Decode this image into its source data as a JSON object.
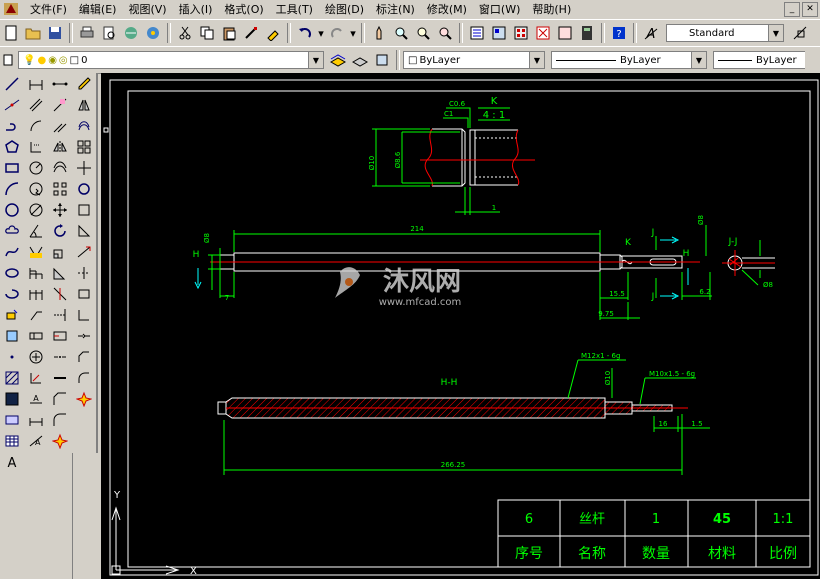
{
  "menu": [
    "文件(F)",
    "编辑(E)",
    "视图(V)",
    "插入(I)",
    "格式(O)",
    "工具(T)",
    "绘图(D)",
    "标注(N)",
    "修改(M)",
    "窗口(W)",
    "帮助(H)"
  ],
  "toolbar": {
    "text_style": "Standard",
    "layer": "0",
    "color": "ByLayer",
    "linetype": "ByLayer",
    "lineweight": "ByLayer"
  },
  "colors": {
    "canvas": "#000000",
    "dim": "#00ff00",
    "geometry": "#ffffff",
    "center": "#ff0000",
    "table_text": "#00ff00"
  },
  "drawing": {
    "detail_label": "K",
    "detail_scale": "4 : 1",
    "chamfer1": "C0.6",
    "chamfer2": "C1",
    "dia10": "Ø10",
    "dia86": "Ø8.6",
    "detail_dim": "1",
    "dim_214": "214",
    "dim_8": "Ø8",
    "dim_7": "7",
    "dim_155": "15.5",
    "dim_975": "9.75",
    "dim_62": "6.2",
    "dim_8b": "Ø8",
    "dim_jj_ph": "Ø8",
    "label_h": "H",
    "label_k": "K",
    "label_j": "J",
    "label_jj": "J-J",
    "label_hh": "H-H",
    "thread1": "M12x1 - 6g",
    "thread2": "M10x1.5 - 6g",
    "dia10b": "Ø10",
    "dim_16": "16",
    "dim_15": "1.5",
    "dim_26625": "266.25",
    "axis_y": "Y",
    "axis_x": "X"
  },
  "title_block": {
    "row1": [
      "6",
      "丝杆",
      "1",
      "45",
      "1:1"
    ],
    "row2": [
      "序号",
      "名称",
      "数量",
      "材料",
      "比例"
    ]
  },
  "watermark": {
    "brand": "沐风网",
    "url": "www.mfcad.com"
  }
}
